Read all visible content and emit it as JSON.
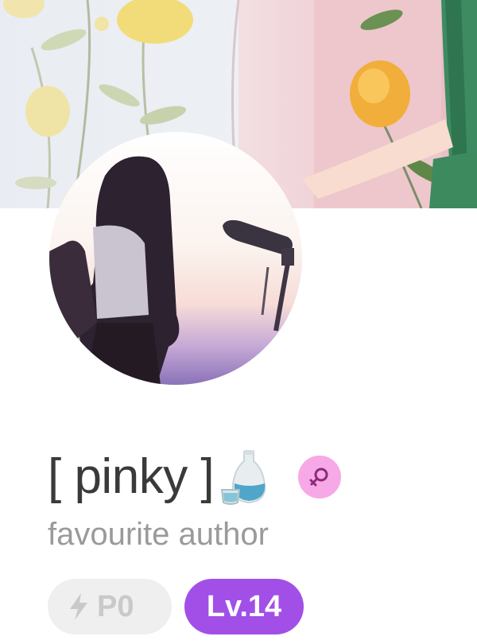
{
  "profile": {
    "username": "[ pinky ]",
    "status_emoji": "sake-bottle-icon",
    "gender_icon": "female-icon",
    "title": "favourite author",
    "points_label": "P0",
    "level_label": "Lv.14"
  },
  "colors": {
    "level_badge": "#a24fe8",
    "gender_badge": "#f7a8e6",
    "points_chip": "#efefef",
    "username_text": "#3a3a3a",
    "subtitle_text": "#9a9a9a"
  }
}
